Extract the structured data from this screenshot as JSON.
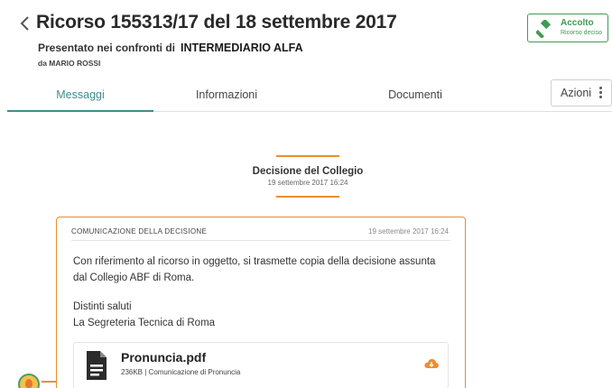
{
  "header": {
    "title": "Ricorso 155313/17 del 18 settembre 2017",
    "presented_label": "Presentato nei confronti di",
    "counterparty": "INTERMEDIARIO ALFA",
    "author": "da MARIO ROSSI"
  },
  "status": {
    "title": "Accolto",
    "subtitle": "Ricorso deciso",
    "color": "#3e9c52",
    "icon": "gavel-icon"
  },
  "tabs": [
    {
      "label": "Messaggi",
      "active": true
    },
    {
      "label": "Informazioni",
      "active": false
    },
    {
      "label": "Documenti",
      "active": false
    }
  ],
  "actions": {
    "label": "Azioni"
  },
  "event": {
    "title": "Decisione del Collegio",
    "date": "19 settembre 2017 16:24"
  },
  "message": {
    "heading": "COMUNICAZIONE DELLA DECISIONE",
    "date": "19 settembre 2017 16:24",
    "body": "Con riferimento al ricorso in oggetto, si trasmette copia della decisione assunta dal Collegio ABF di Roma.",
    "greeting": "Distinti saluti",
    "signature": "La Segreteria Tecnica di Roma"
  },
  "attachment": {
    "name": "Pronuncia.pdf",
    "meta": "236KB | Comunicazione di Pronuncia",
    "icon": "document-icon",
    "download_icon": "cloud-download-icon"
  },
  "colors": {
    "accent": "#ef8c2e",
    "tab_active": "#3e8e8a",
    "success": "#3e9c52"
  }
}
